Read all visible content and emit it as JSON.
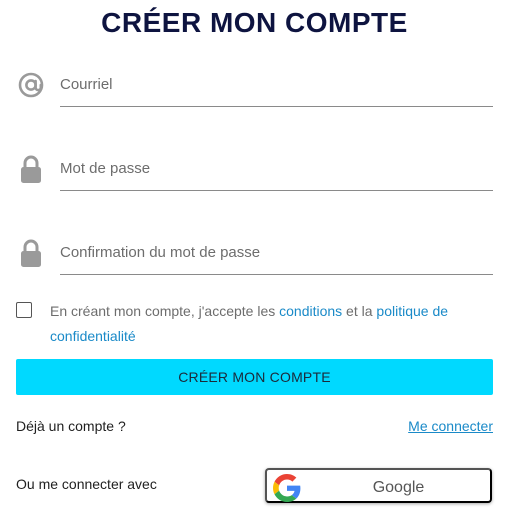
{
  "page": {
    "title": "CRÉER MON COMPTE"
  },
  "form": {
    "email_placeholder": "Courriel",
    "password_placeholder": "Mot de passe",
    "confirm_placeholder": "Confirmation du mot de passe",
    "email_icon": "at-icon",
    "password_icon": "lock-icon",
    "confirm_icon": "lock-icon"
  },
  "terms": {
    "checked": false,
    "prefix": "En créant mon compte, j'accepte les ",
    "conditions_link": "conditions",
    "middle": " et la ",
    "privacy_link": "politique de confidentialité"
  },
  "submit_label": "CRÉER MON COMPTE",
  "already_account": "Déjà un compte ?",
  "login_link": "Me connecter",
  "or_connect": "Ou me connecter avec",
  "google_button": "Google",
  "colors": {
    "title": "#0e1440",
    "primary_button": "#00d9ff",
    "link": "#1a8ac8",
    "icon": "#9a9a9a"
  }
}
